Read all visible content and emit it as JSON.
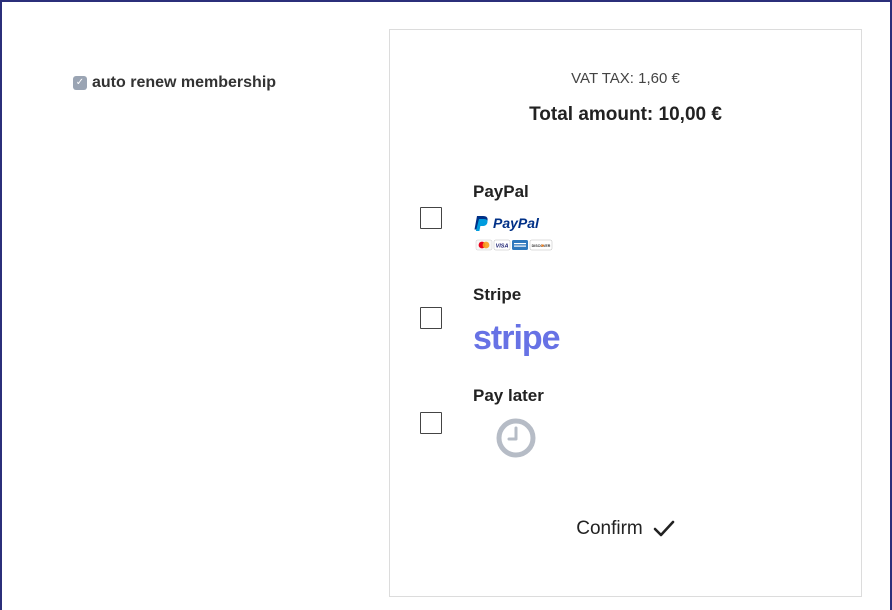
{
  "auto_renew": {
    "label": "auto renew membership",
    "checked": true
  },
  "summary": {
    "vat": "VAT TAX: 1,60 €",
    "total": "Total amount: 10,00 €"
  },
  "payment_methods": [
    {
      "name": "PayPal",
      "logo_icon": "paypal-logo",
      "logo_text": "PayPal",
      "cards": [
        "MasterCard",
        "VISA",
        "AMEX",
        "DISCOVER"
      ],
      "checked": false
    },
    {
      "name": "Stripe",
      "logo_icon": "stripe-logo",
      "logo_text": "stripe",
      "checked": false
    },
    {
      "name": "Pay later",
      "logo_icon": "clock-icon",
      "checked": false
    }
  ],
  "confirm": {
    "label": "Confirm",
    "icon": "checkmark-icon"
  },
  "colors": {
    "frame": "#2b2f7a",
    "paypal_dark": "#003087",
    "paypal_light": "#009cde",
    "stripe": "#6772e5",
    "checkbox_checked": "#9aa4b3"
  }
}
